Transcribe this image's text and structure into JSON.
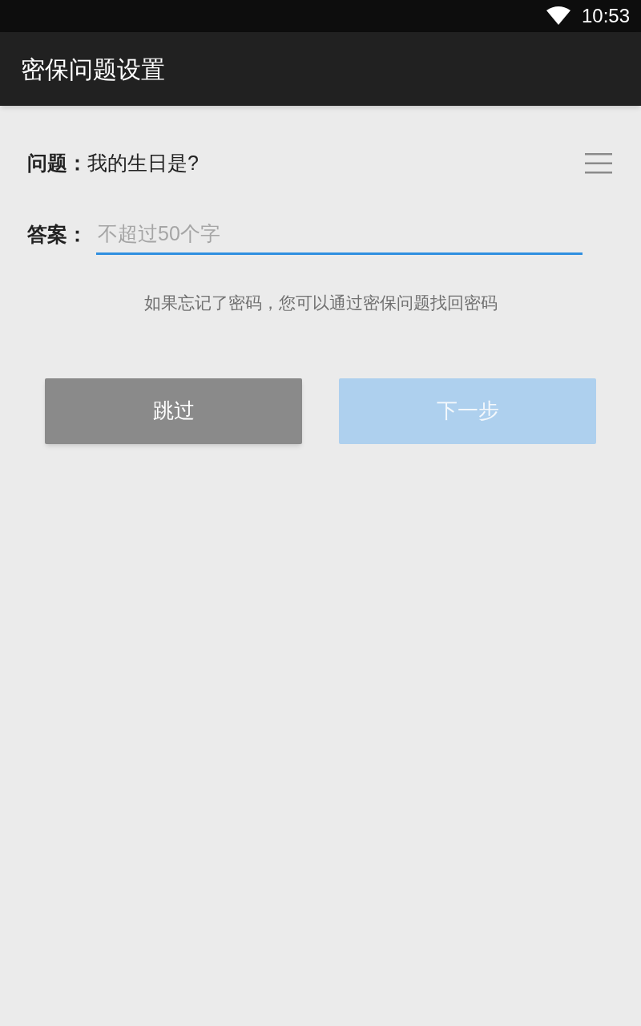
{
  "status_bar": {
    "time": "10:53"
  },
  "toolbar": {
    "title": "密保问题设置"
  },
  "question": {
    "label": "问题：",
    "value": "我的生日是?"
  },
  "answer": {
    "label": "答案：",
    "placeholder": "不超过50个字"
  },
  "hint": "如果忘记了密码，您可以通过密保问题找回密码",
  "buttons": [
    {
      "label": "跳过",
      "disabled": false,
      "kind": "secondary"
    },
    {
      "label": "下一步",
      "disabled": true,
      "kind": "primary"
    }
  ]
}
